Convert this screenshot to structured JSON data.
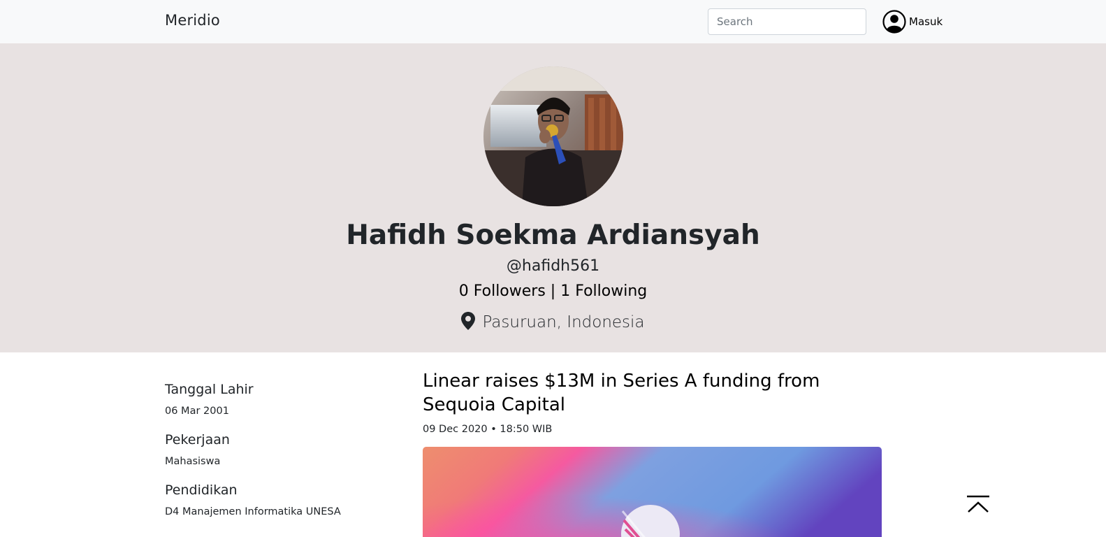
{
  "navbar": {
    "brand": "Meridio",
    "search_placeholder": "Search",
    "login_label": "Masuk",
    "login_icon": "user-circle-icon"
  },
  "profile": {
    "name": "Hafidh Soekma Ardiansyah",
    "username": "@hafidh561",
    "followers_text": "0 Followers | 1 Following",
    "location": "Pasuruan, Indonesia",
    "location_icon": "map-marker-icon",
    "hero_background": "#e8e2e2"
  },
  "info": [
    {
      "label": "Tanggal Lahir",
      "value": "06 Mar 2001"
    },
    {
      "label": "Pekerjaan",
      "value": "Mahasiswa"
    },
    {
      "label": "Pendidikan",
      "value": "D4 Manajemen Informatika UNESA"
    }
  ],
  "article": {
    "title": "Linear raises $13M in Series A funding from Sequoia Capital",
    "meta": "09 Dec 2020 • 18:50 WIB"
  },
  "back_to_top_icon": "chevron-up-bar-icon"
}
